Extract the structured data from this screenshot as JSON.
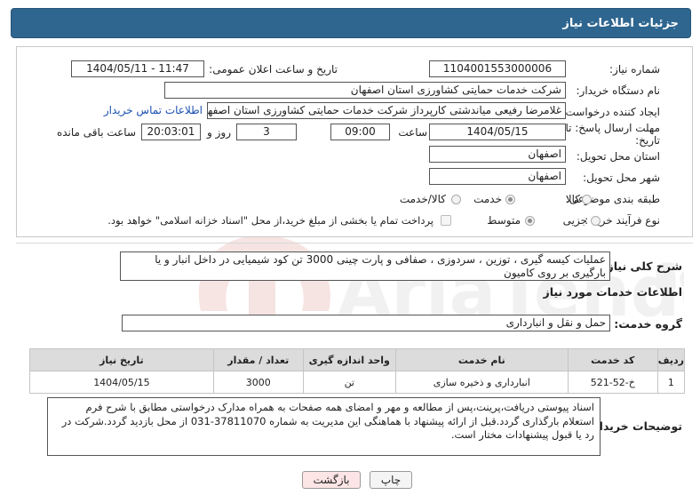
{
  "header": {
    "title": "جزئیات اطلاعات نیاز"
  },
  "fields": {
    "need_number_label": "شماره نیاز:",
    "need_number": "1104001553000006",
    "announce_label": "تاریخ و ساعت اعلان عمومی:",
    "announce_value": "1404/05/11 - 11:47",
    "buyer_org_label": "نام دستگاه خریدار:",
    "buyer_org": "شرکت خدمات حمایتی کشاورزی استان اصفهان",
    "requester_label": "ایجاد کننده درخواست:",
    "requester": "غلامرضا  رفیعی میاندشتی کارپرداز شرکت خدمات حمایتی کشاورزی استان اصفهان",
    "contact_link": "اطلاعات تماس خریدار",
    "deadline_label_1": "مهلت ارسال پاسخ: تا",
    "deadline_label_2": "تاریخ:",
    "deadline_date": "1404/05/15",
    "time_label": "ساعت",
    "deadline_time": "09:00",
    "days_value": "3",
    "days_label": "روز و",
    "remaining_time": "20:03:01",
    "remaining_label": "ساعت باقی مانده",
    "province_label": "استان محل تحویل:",
    "province": "اصفهان",
    "city_label": "شهر محل تحویل:",
    "city": "اصفهان",
    "category_label": "طبقه بندی موضوعی:",
    "category_options": [
      "کالا",
      "خدمت",
      "کالا/خدمت"
    ],
    "category_selected": "خدمت",
    "process_label": "نوع فرآیند خرید :",
    "process_options": [
      "جزیی",
      "متوسط"
    ],
    "process_selected": "متوسط",
    "payment_note": "پرداخت تمام یا بخشی از مبلغ خرید،از محل \"اسناد خزانه اسلامی\" خواهد بود."
  },
  "summary": {
    "label": "شرح کلی نیاز:",
    "text": "عملیات کیسه گیری ، توزین ، سردوزی ، صفافی و پارت چینی 3000 تن کود شیمیایی در داخل انبار و یا بارگیری بر روی کامیون"
  },
  "services": {
    "section_title": "اطلاعات خدمات مورد نیاز",
    "group_label": "گروه خدمت:",
    "group_value": "حمل و نقل و انبارداری",
    "columns": [
      "ردیف",
      "کد خدمت",
      "نام خدمت",
      "واحد اندازه گیری",
      "تعداد / مقدار",
      "تاریخ نیاز"
    ],
    "rows": [
      {
        "idx": "1",
        "code": "خ-52-521",
        "name": "انبارداری و ذخیره سازی",
        "unit": "تن",
        "qty": "3000",
        "date": "1404/05/15"
      }
    ]
  },
  "buyer_notes": {
    "label": "توضیحات خریدار:",
    "text": "اسناد پیوستی دریافت،پرینت،پس از مطالعه و مهر و امضای همه صفحات به همراه مدارک درخواستی مطابق با شرح فرم استعلام بارگذاری گردد.قبل از ارائه پیشنهاد با هماهنگی این مدیریت به شماره 37811070-031 از محل بازدید گردد.شرکت در رد یا قبول پیشنهادات مختار است."
  },
  "buttons": {
    "print": "چاپ",
    "back": "بازگشت"
  },
  "colors": {
    "header_bg": "#2f6690",
    "back_button_bg": "#fde5e5",
    "link": "#1a4fb0"
  }
}
